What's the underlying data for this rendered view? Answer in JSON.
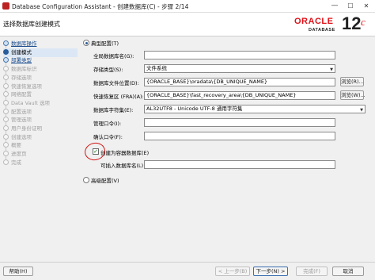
{
  "window": {
    "title": "Database Configuration Assistant - 创建数据库(C) - 步骤 2/14",
    "minimize": "—",
    "maximize": "☐",
    "close": "✕"
  },
  "header": {
    "page_title": "选择数据库创建模式",
    "brand_word": "ORACLE",
    "brand_sub": "DATABASE",
    "version": "12",
    "version_suffix": "c"
  },
  "steps": [
    {
      "label": "数据库操作",
      "state": "done"
    },
    {
      "label": "创建模式",
      "state": "current"
    },
    {
      "label": "部署类型",
      "state": "done"
    },
    {
      "label": "数据库标识",
      "state": "pending"
    },
    {
      "label": "存储选项",
      "state": "pending"
    },
    {
      "label": "快速恢复选项",
      "state": "pending"
    },
    {
      "label": "网络配置",
      "state": "pending"
    },
    {
      "label": "Data Vault 选项",
      "state": "pending"
    },
    {
      "label": "配置选项",
      "state": "pending"
    },
    {
      "label": "管理选项",
      "state": "pending"
    },
    {
      "label": "用户身份证明",
      "state": "pending"
    },
    {
      "label": "创建选项",
      "state": "pending"
    },
    {
      "label": "概要",
      "state": "pending"
    },
    {
      "label": "进度页",
      "state": "pending"
    },
    {
      "label": "完成",
      "state": "pending"
    }
  ],
  "form": {
    "typical_label": "典型配置(T)",
    "global_db_name_label": "全局数据库名(G):",
    "global_db_name_value": "",
    "storage_type_label": "存储类型(S):",
    "storage_type_value": "文件系统",
    "db_file_location_label": "数据库文件位置(D):",
    "db_file_location_value": "{ORACLE_BASE}\\oradata\\{DB_UNIQUE_NAME}",
    "fra_label": "快速恢复区 (FRA)(A):",
    "fra_value": "{ORACLE_BASE}\\fast_recovery_area\\{DB_UNIQUE_NAME}",
    "charset_label": "数据库字符集(E):",
    "charset_value": "AL32UTF8 - Unicode UTF-8 通用字符集",
    "admin_pwd_label": "管理口令(I):",
    "confirm_pwd_label": "确认口令(F):",
    "container_checkbox_label": "创建为容器数据库(E)",
    "container_checked": "✓",
    "pluggable_label": "可插入数据库名(L):",
    "advanced_label": "高级配置(V)",
    "browse_label": "浏览(R)...",
    "browse2_label": "浏览(W)..."
  },
  "footer": {
    "help": "帮助(H)",
    "back": "< 上一步(B)",
    "next": "下一步(N) >",
    "finish": "完成(F)",
    "cancel": "取消"
  }
}
